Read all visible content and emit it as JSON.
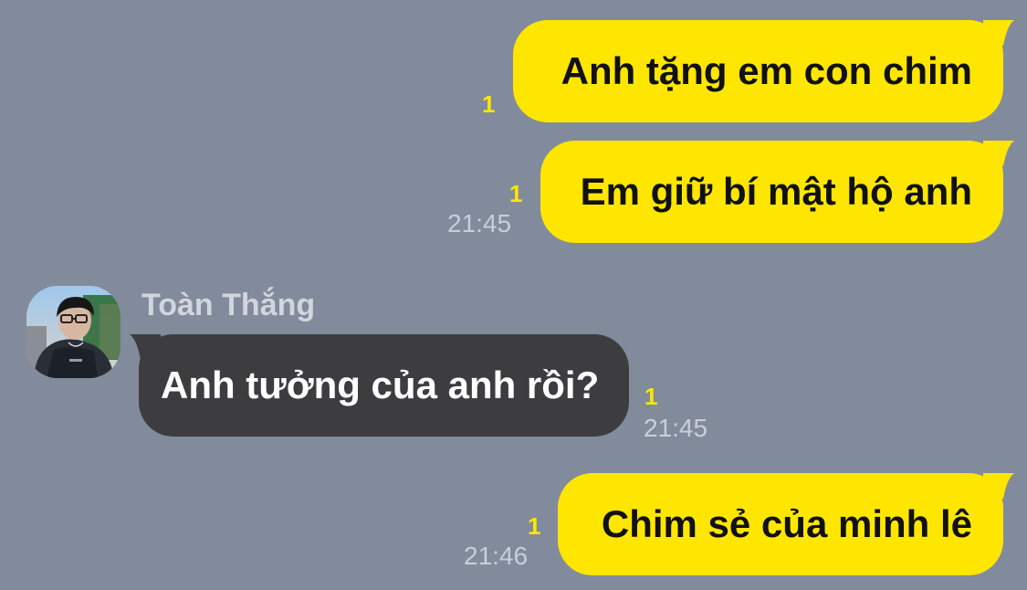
{
  "messages": [
    {
      "id": "m1",
      "direction": "outgoing",
      "text": "Anh tặng em con chim",
      "unread": "1",
      "time": ""
    },
    {
      "id": "m2",
      "direction": "outgoing",
      "text": "Em giữ bí mật hộ anh",
      "unread": "1",
      "time": "21:45"
    },
    {
      "id": "m3",
      "direction": "incoming",
      "sender": "Toàn Thắng",
      "text": "Anh tưởng của anh rồi?",
      "unread": "1",
      "time": "21:45"
    },
    {
      "id": "m4",
      "direction": "outgoing",
      "text": "Chim sẻ của minh lê",
      "unread": "1",
      "time": "21:46"
    }
  ],
  "colors": {
    "background": "#828b9c",
    "outgoing_bubble": "#ffe600",
    "incoming_bubble": "#3d3d3f",
    "unread": "#ffe600",
    "timestamp": "#c9ced8",
    "sender_name": "#d1d5de"
  },
  "icons": {
    "avatar": "profile-photo"
  }
}
